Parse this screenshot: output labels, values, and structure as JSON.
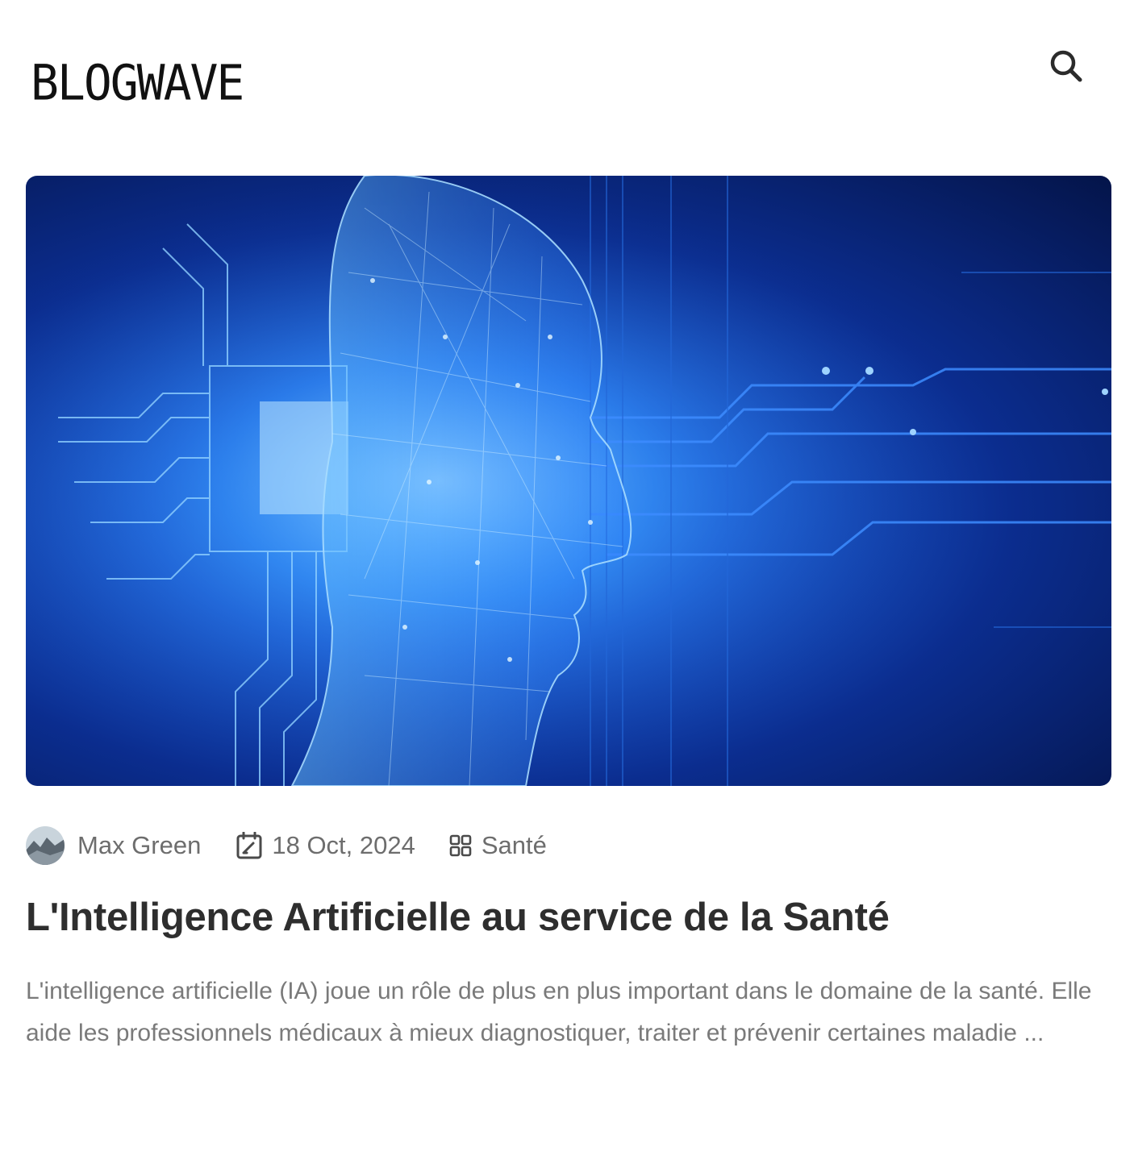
{
  "header": {
    "logo": "BLOGWAVE",
    "search_icon": "search-icon"
  },
  "hero": {
    "image": "ai-face-circuit-blue"
  },
  "post": {
    "author": "Max Green",
    "date": "18 Oct, 2024",
    "category": "Santé",
    "title": "L'Intelligence Artificielle au service de la Santé",
    "excerpt": "L'intelligence artificielle (IA) joue un rôle de plus en plus important dans le domaine de la santé. Elle aide les professionnels médicaux à mieux diagnostiquer, traiter et prévenir certaines maladie ..."
  },
  "icons": {
    "date": "calendar-icon",
    "category": "category-grid-icon"
  },
  "colors": {
    "title": "#2e2e2e",
    "meta": "#6d6d6d",
    "excerpt": "#7a7a7a",
    "hero_primary": "#1d5fd6",
    "hero_dark": "#041449"
  }
}
